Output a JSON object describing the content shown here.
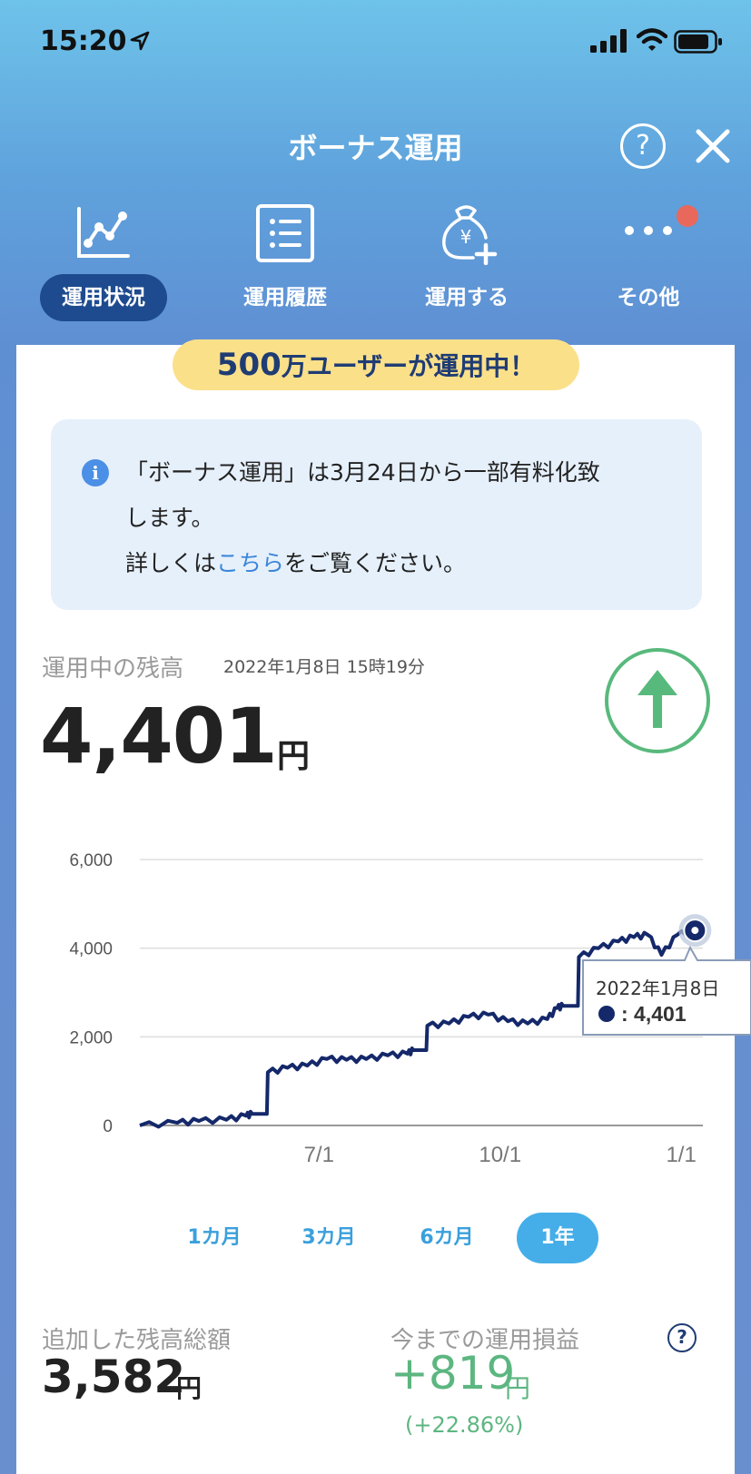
{
  "status": {
    "time": "15:20"
  },
  "header": {
    "title": "ボーナス運用",
    "help": "?"
  },
  "nav": {
    "items": [
      {
        "label": "運用状況"
      },
      {
        "label": "運用履歴"
      },
      {
        "label": "運用する"
      },
      {
        "label": "その他"
      }
    ]
  },
  "promo": {
    "number": "500",
    "text": "万ユーザーが運用中！"
  },
  "notice": {
    "line1": "「ボーナス運用」は3月24日から一部有料化致",
    "line2": "します。",
    "line3_prefix": "詳しくは",
    "line3_link": "こちら",
    "line3_suffix": "をご覧ください。"
  },
  "balance": {
    "label": "運用中の残高",
    "date": "2022年1月8日 15時19分",
    "amount": "4,401",
    "unit": "円"
  },
  "chart_data": {
    "type": "line",
    "yticks": [
      "6,000",
      "4,000",
      "2,000",
      "0"
    ],
    "xticks": [
      "7/1",
      "10/1",
      "1/1"
    ],
    "ylim": [
      0,
      6000
    ],
    "x": [
      "2021-04-01",
      "2021-04-20",
      "2021-05-01",
      "2021-05-15",
      "2021-05-25",
      "2021-05-28",
      "2021-06-05",
      "2021-06-15",
      "2021-06-25",
      "2021-07-05",
      "2021-07-15",
      "2021-07-25",
      "2021-08-05",
      "2021-08-15",
      "2021-08-18",
      "2021-08-25",
      "2021-09-05",
      "2021-09-15",
      "2021-09-25",
      "2021-10-05",
      "2021-10-15",
      "2021-10-25",
      "2021-10-30",
      "2021-11-02",
      "2021-11-10",
      "2021-11-20",
      "2021-11-30",
      "2021-12-08",
      "2021-12-15",
      "2021-12-22",
      "2021-12-30",
      "2022-01-08"
    ],
    "values": [
      0,
      60,
      100,
      130,
      220,
      260,
      1200,
      1300,
      1350,
      1500,
      1480,
      1500,
      1580,
      1620,
      1700,
      2250,
      2300,
      2450,
      2500,
      2350,
      2300,
      2400,
      2650,
      2700,
      3800,
      4000,
      4150,
      4250,
      4300,
      3850,
      4300,
      4401
    ],
    "tooltip": {
      "date": "2022年1月8日",
      "value": "4,401"
    },
    "line_color": "#14286a"
  },
  "ranges": {
    "items": [
      "1カ月",
      "3カ月",
      "6カ月",
      "1年"
    ],
    "active": "1年"
  },
  "summary": {
    "added_label": "追加した残高総額",
    "added_amount": "3,582",
    "added_unit": "円",
    "pl_label": "今までの運用損益",
    "pl_amount": "+819",
    "pl_unit": "円",
    "pl_pct": "(+22.86%)",
    "pl_help": "?"
  }
}
